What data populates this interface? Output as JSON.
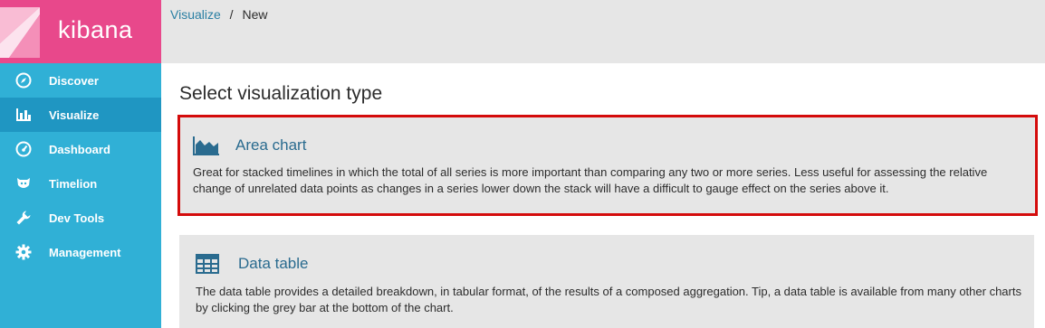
{
  "brand": {
    "name": "kibana"
  },
  "nav": {
    "items": [
      {
        "label": "Discover",
        "icon": "compass-icon",
        "active": false
      },
      {
        "label": "Visualize",
        "icon": "bar-chart-icon",
        "active": true
      },
      {
        "label": "Dashboard",
        "icon": "dashboard-icon",
        "active": false
      },
      {
        "label": "Timelion",
        "icon": "timelion-icon",
        "active": false
      },
      {
        "label": "Dev Tools",
        "icon": "wrench-icon",
        "active": false
      },
      {
        "label": "Management",
        "icon": "gear-icon",
        "active": false
      }
    ]
  },
  "breadcrumb": {
    "parent": "Visualize",
    "separator": "/",
    "current": "New"
  },
  "main": {
    "title": "Select visualization type",
    "types": [
      {
        "title": "Area chart",
        "icon": "area-chart-icon",
        "description": "Great for stacked timelines in which the total of all series is more important than comparing any two or more series. Less useful for assessing the relative change of unrelated data points as changes in a series lower down the stack will have a difficult to gauge effect on the series above it."
      },
      {
        "title": "Data table",
        "icon": "table-icon",
        "description": "The data table provides a detailed breakdown, in tabular format, of the results of a composed aggregation. Tip, a data table is available from many other charts by clicking the grey bar at the bottom of the chart."
      }
    ]
  },
  "colors": {
    "sidebar": "#30b0d6",
    "sidebar_active": "#1f96c2",
    "brand": "#e8488b",
    "highlight_border": "#d40b0b",
    "card_bg": "#e6e6e6",
    "link": "#2a7fa3"
  }
}
